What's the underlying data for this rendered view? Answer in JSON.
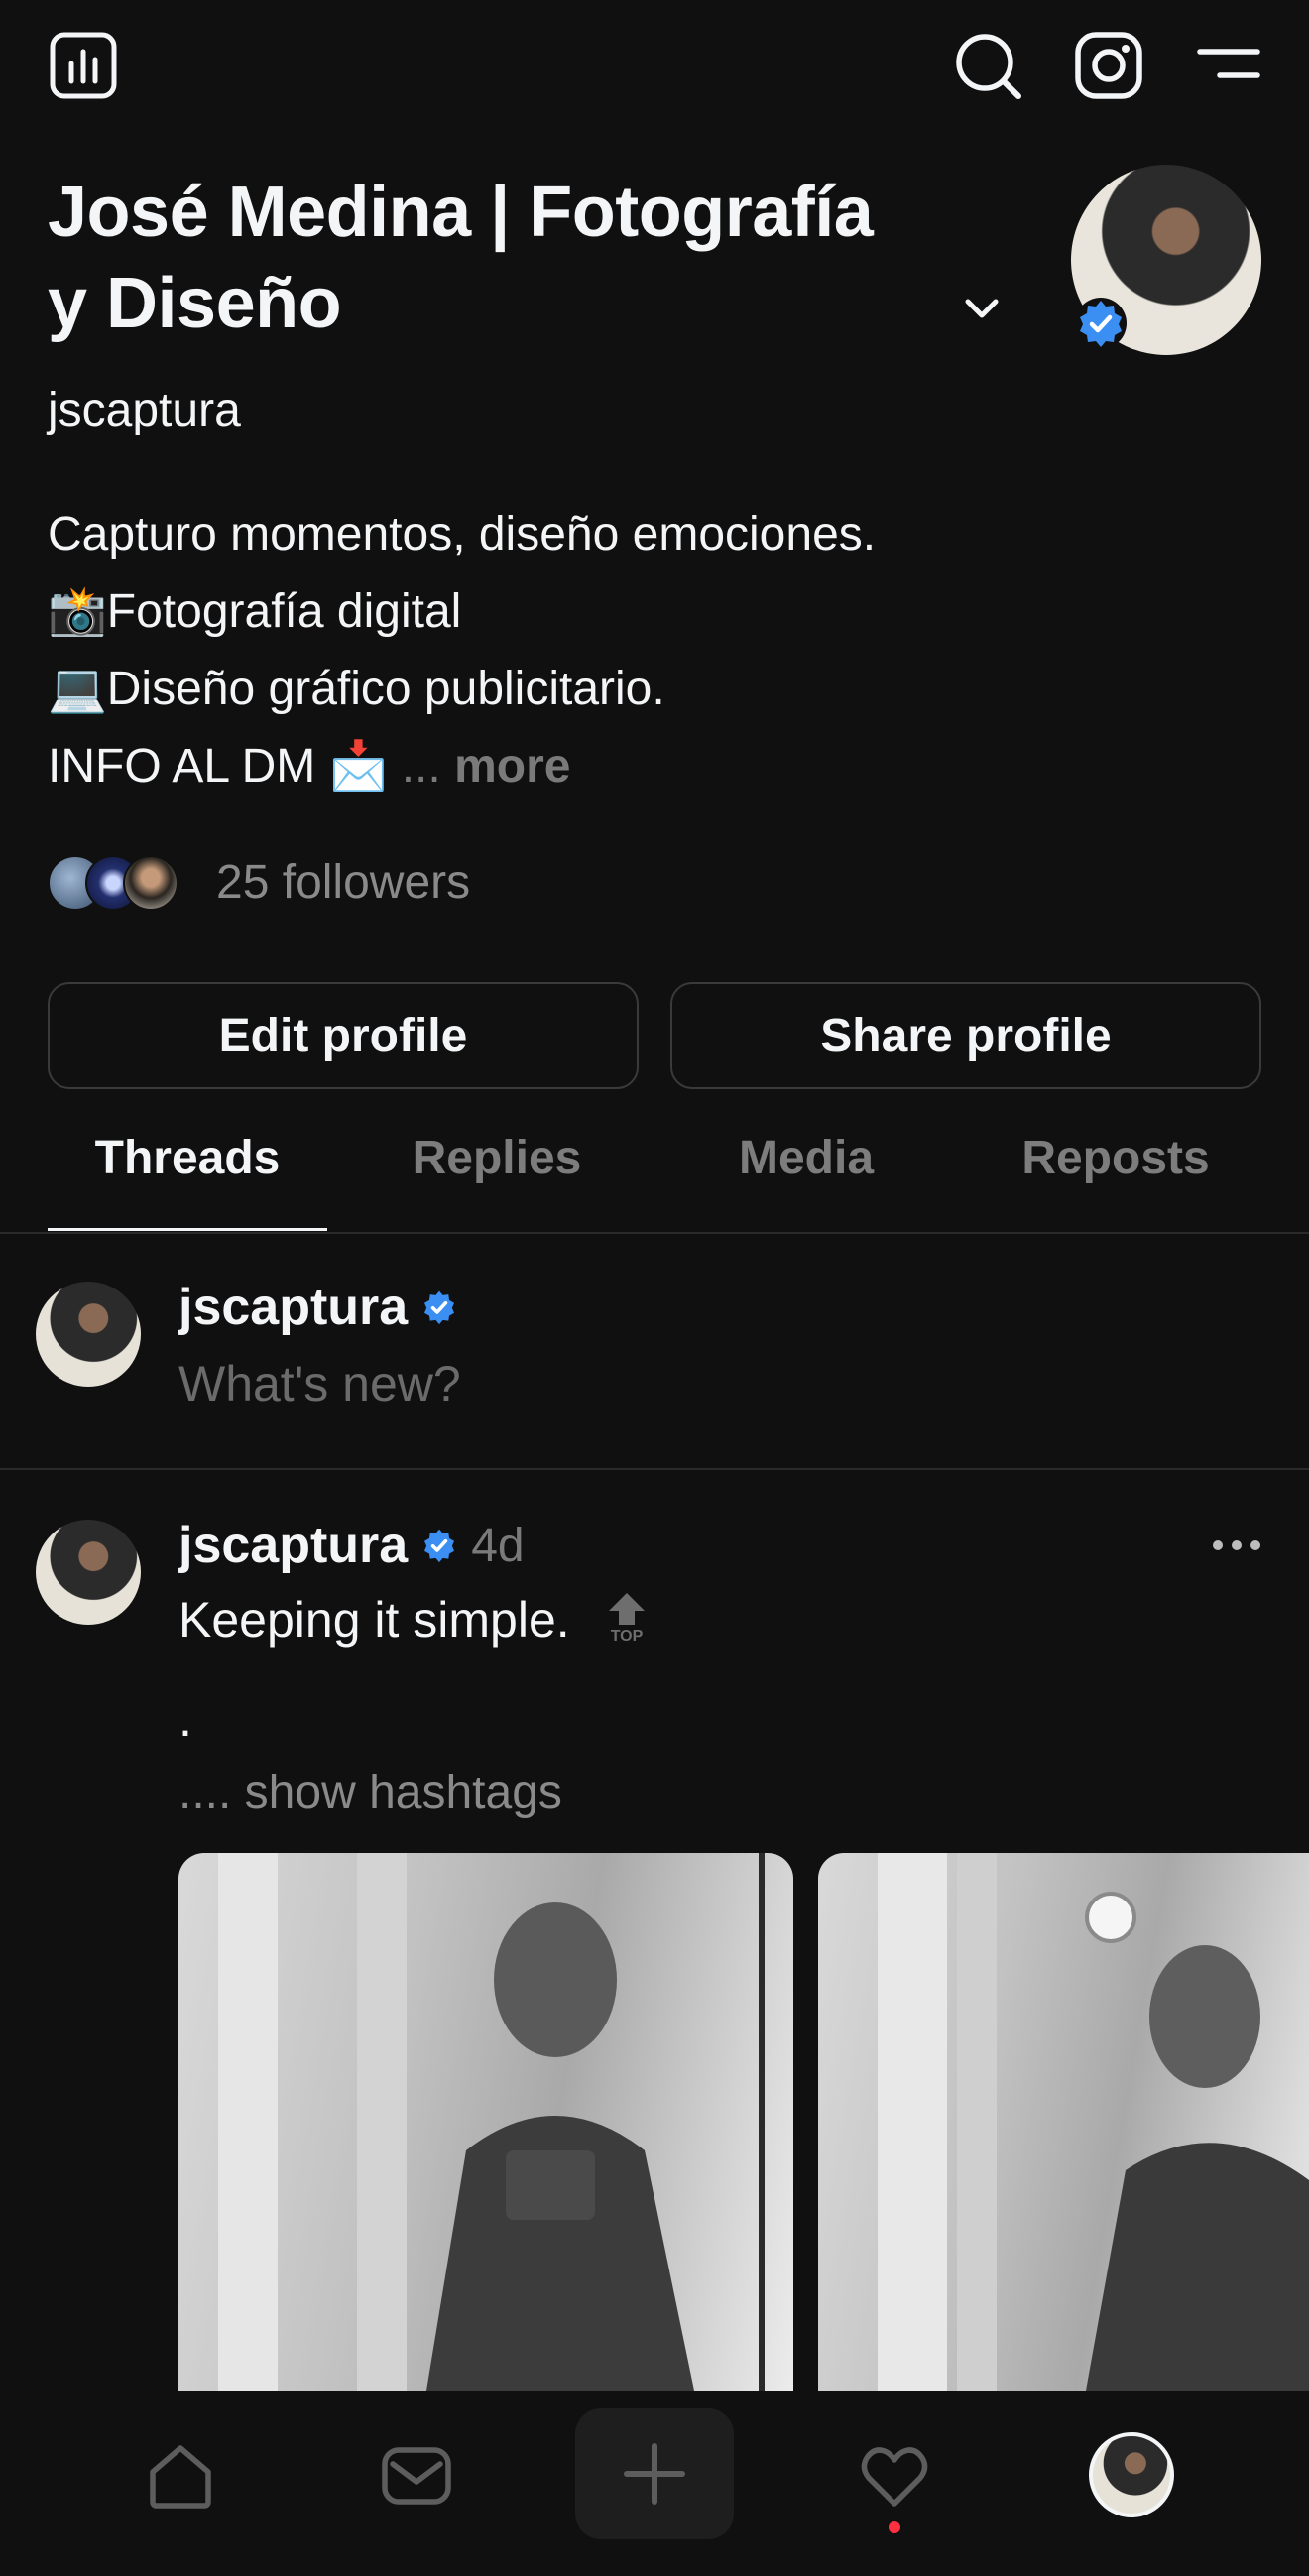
{
  "header": {
    "icons": [
      "insights-icon",
      "search-icon",
      "instagram-icon",
      "menu-icon"
    ]
  },
  "profile": {
    "name_line1": "José Medina | Fotografía",
    "name_line2": "y Diseño",
    "handle": "jscaptura",
    "bio_lines": [
      "Capturo momentos, diseño emociones.",
      "📸Fotografía digital",
      "💻Diseño gráfico publicitario.",
      "INFO AL DM 📩"
    ],
    "bio_ellipsis": "...",
    "more_label": "more",
    "followers_label": "25 followers"
  },
  "actions": {
    "edit_label": "Edit profile",
    "share_label": "Share profile"
  },
  "tabs": [
    {
      "label": "Threads",
      "active": true
    },
    {
      "label": "Replies",
      "active": false
    },
    {
      "label": "Media",
      "active": false
    },
    {
      "label": "Reposts",
      "active": false
    }
  ],
  "composer": {
    "username": "jscaptura",
    "placeholder": "What's new?"
  },
  "post": {
    "username": "jscaptura",
    "time": "4d",
    "text": "Keeping it simple.",
    "top_badge": "TOP",
    "dot": ".",
    "hashtags_label": ".... show hashtags"
  },
  "bottom_nav": {
    "icons": [
      "home-icon",
      "inbox-icon",
      "compose-icon",
      "activity-icon",
      "profile-avatar"
    ]
  },
  "colors": {
    "background": "#101010",
    "text": "#f3f5f7",
    "muted": "#7a7a7a",
    "verified": "#3b8ff3",
    "notification": "#ff3040"
  }
}
